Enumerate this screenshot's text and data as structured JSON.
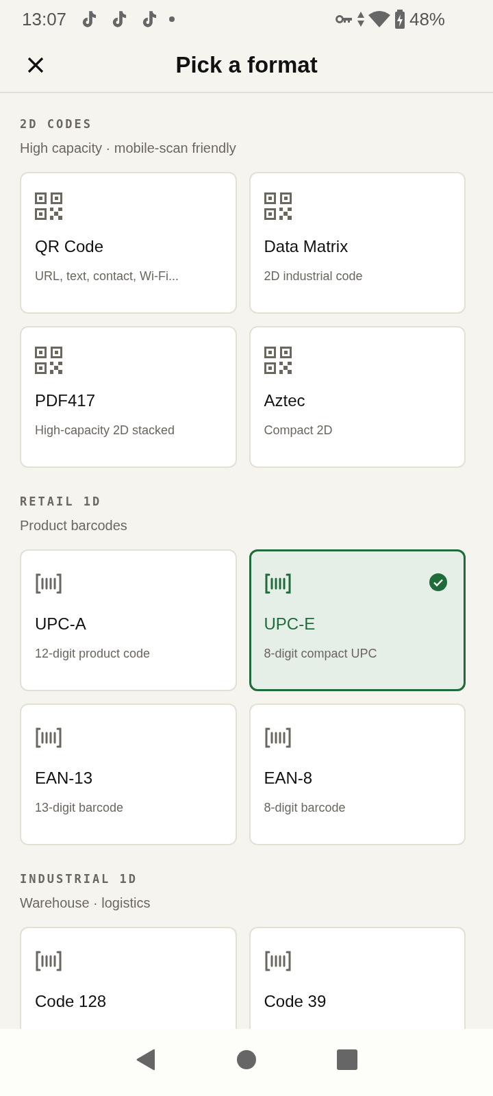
{
  "status_bar": {
    "time": "13:07",
    "battery": "48%"
  },
  "header": {
    "title": "Pick a format"
  },
  "sections": [
    {
      "label": "2D CODES",
      "subtitle": "High capacity · mobile-scan friendly",
      "cards": [
        {
          "kind": "qr",
          "title": "QR Code",
          "description": "URL, text, contact, Wi-Fi...",
          "selected": false
        },
        {
          "kind": "qr",
          "title": "Data Matrix",
          "description": "2D industrial code",
          "selected": false
        },
        {
          "kind": "qr",
          "title": "PDF417",
          "description": "High-capacity 2D stacked",
          "selected": false
        },
        {
          "kind": "qr",
          "title": "Aztec",
          "description": "Compact 2D",
          "selected": false
        }
      ]
    },
    {
      "label": "RETAIL 1D",
      "subtitle": "Product barcodes",
      "cards": [
        {
          "kind": "barcode",
          "title": "UPC-A",
          "description": "12-digit product code",
          "selected": false
        },
        {
          "kind": "barcode",
          "title": "UPC-E",
          "description": "8-digit compact UPC",
          "selected": true
        },
        {
          "kind": "barcode",
          "title": "EAN-13",
          "description": "13-digit barcode",
          "selected": false
        },
        {
          "kind": "barcode",
          "title": "EAN-8",
          "description": "8-digit barcode",
          "selected": false
        }
      ]
    },
    {
      "label": "INDUSTRIAL 1D",
      "subtitle": "Warehouse · logistics",
      "cards": [
        {
          "kind": "barcode",
          "title": "Code 128",
          "selected": false
        },
        {
          "kind": "barcode",
          "title": "Code 39",
          "selected": false
        }
      ]
    }
  ]
}
